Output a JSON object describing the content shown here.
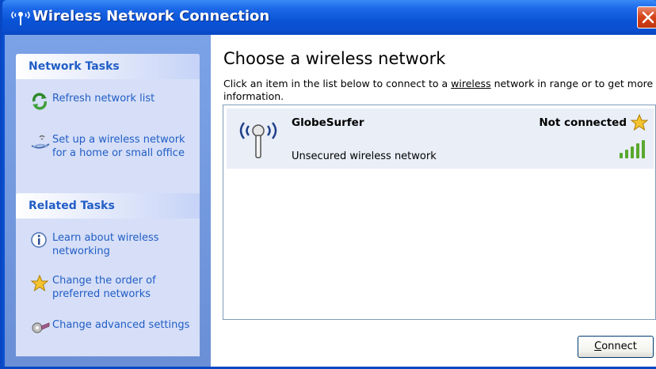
{
  "window": {
    "title": "Wireless Network Connection",
    "title_icon": "wireless-antenna-icon",
    "close_icon": "close-icon"
  },
  "left_pane": {
    "network_tasks": {
      "header": "Network Tasks",
      "items": [
        {
          "label": "Refresh network list",
          "icon": "refresh-icon"
        },
        {
          "label": "Set up a wireless network for a home or small office",
          "icon": "setup-wizard-icon"
        }
      ]
    },
    "related_tasks": {
      "header": "Related Tasks",
      "items": [
        {
          "label": "Learn about wireless networking",
          "icon": "info-icon"
        },
        {
          "label": "Change the order of preferred networks",
          "icon": "star-icon"
        },
        {
          "label": "Change advanced settings",
          "icon": "settings-icon"
        }
      ]
    }
  },
  "main": {
    "heading": "Choose a wireless network",
    "instructions_pre": "Click an item in the list below to connect to a ",
    "instructions_link": "wireless",
    "instructions_post": " network in range or to get more information.",
    "networks": [
      {
        "name": "GlobeSurfer",
        "status": "Not connected",
        "security": "Unsecured wireless network",
        "signal_bars": 5,
        "signal_strength_fraction": 1.0
      }
    ],
    "connect_button": {
      "accesskey": "C",
      "rest": "onnect"
    }
  },
  "colors": {
    "titlebar": "#0a53d6",
    "task_header_text": "#215dc6",
    "selected_row": "#e9eef7",
    "signal": "#5aa82e",
    "star": "#f4b400"
  }
}
